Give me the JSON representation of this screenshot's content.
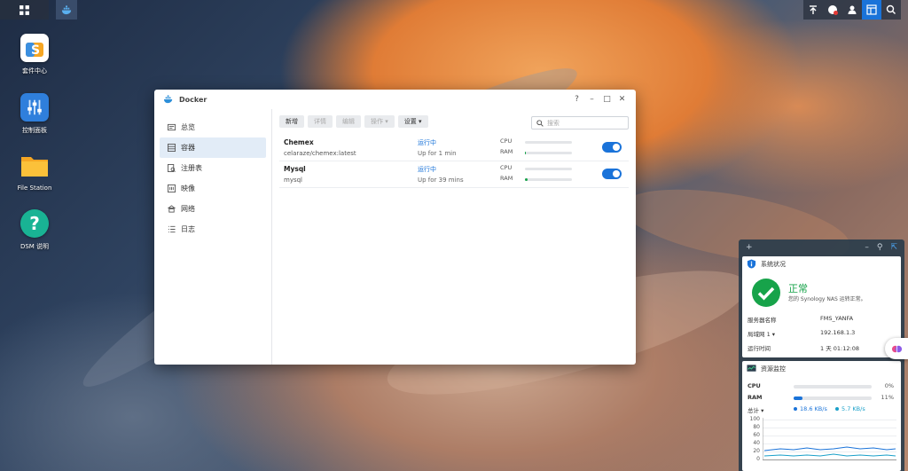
{
  "desktop_icons": [
    {
      "label": "套件中心",
      "icon": "package-center-icon"
    },
    {
      "label": "控制面板",
      "icon": "control-panel-icon"
    },
    {
      "label": "File Station",
      "icon": "folder-icon"
    },
    {
      "label": "DSM 说明",
      "icon": "help-icon"
    }
  ],
  "window": {
    "title": "Docker",
    "controls": [
      "?",
      "–",
      "□",
      "✕"
    ],
    "sidebar": [
      {
        "label": "总览",
        "icon": "overview-icon"
      },
      {
        "label": "容器",
        "icon": "container-icon",
        "active": true
      },
      {
        "label": "注册表",
        "icon": "registry-icon"
      },
      {
        "label": "映像",
        "icon": "image-icon"
      },
      {
        "label": "网络",
        "icon": "network-icon"
      },
      {
        "label": "日志",
        "icon": "log-icon"
      }
    ],
    "toolbar": {
      "new": "新增",
      "details": "详情",
      "edit": "编辑",
      "action": "操作 ▾",
      "settings": "设置 ▾"
    },
    "search_placeholder": "搜索",
    "containers": [
      {
        "name": "Chemex",
        "image": "celaraze/chemex:latest",
        "status": "运行中",
        "uptime": "Up for 1 min",
        "cpu_label": "CPU",
        "ram_label": "RAM",
        "cpu": 0.0,
        "ram": 0.02,
        "enabled": true
      },
      {
        "name": "Mysql",
        "image": "mysql",
        "status": "运行中",
        "uptime": "Up for 39 mins",
        "cpu_label": "CPU",
        "ram_label": "RAM",
        "cpu": 0.0,
        "ram": 0.05,
        "enabled": true
      }
    ]
  },
  "widgets": {
    "header_add": "+",
    "header_controls": [
      "–",
      "⚲",
      "⇱"
    ],
    "system": {
      "title": "系统状况",
      "status": "正常",
      "status_desc": "您的 Synology NAS 运转正常。",
      "server_name_label": "服务器名称",
      "server_name": "FMS_YANFA",
      "lan_label": "局域网 1 ▾",
      "lan_ip": "192.168.1.3",
      "uptime_label": "运行时间",
      "uptime": "1 天 01:12:08"
    },
    "resource": {
      "title": "资源监控",
      "cpu_label": "CPU",
      "cpu_pct": "0%",
      "cpu": 0.0,
      "ram_label": "RAM",
      "ram_pct": "11%",
      "ram": 0.11,
      "total_label": "总计 ▾",
      "up_speed": "18.6 KB/s",
      "down_speed": "5.7 KB/s",
      "y_ticks": [
        "100",
        "80",
        "60",
        "40",
        "20",
        "0"
      ]
    }
  },
  "colors": {
    "accent": "#1a73d9",
    "ok_green": "#17a34a"
  }
}
